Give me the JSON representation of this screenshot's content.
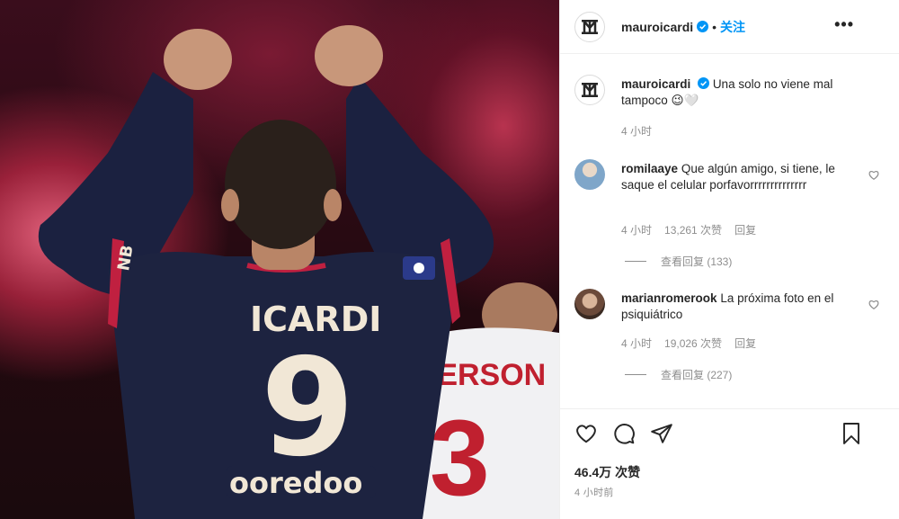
{
  "colors": {
    "accent": "#0095f6",
    "text": "#262626",
    "muted": "#8e8e8e",
    "border": "#efefef",
    "jersey": "#1d2340",
    "jersey_red": "#c02040"
  },
  "photo": {
    "jersey_name": "ICARDI",
    "jersey_number": "9",
    "sponsor": "ooredoo",
    "sleeve_text": "NB",
    "second_player_name": "MERSON",
    "second_player_number": "3"
  },
  "header": {
    "username": "mauroicardi",
    "follow_label": "关注",
    "separator": "•",
    "more_label": "•••"
  },
  "caption": {
    "username": "mauroicardi",
    "text": "Una solo no viene mal tampoco 😉🤍",
    "time": "4 小时"
  },
  "comments": [
    {
      "username": "romilaaye",
      "text": "Que algún amigo, si tiene, le saque el celular porfavorrrrrrrrrrrrrr",
      "time": "4 小时",
      "likes": "13,261 次赞",
      "reply_label": "回复",
      "view_replies": "查看回复 (133)"
    },
    {
      "username": "marianromerook",
      "text": "La próxima foto en el psiquiátrico",
      "time": "4 小时",
      "likes": "19,026 次赞",
      "reply_label": "回复",
      "view_replies": "查看回复 (227)"
    }
  ],
  "footer": {
    "likes": "46.4万 次赞",
    "time": "4 小时前"
  },
  "icons": {
    "like": "heart-icon",
    "comment": "comment-icon",
    "share": "paper-plane-icon",
    "save": "bookmark-icon",
    "verified": "verified-badge-icon",
    "more": "more-options-icon"
  }
}
